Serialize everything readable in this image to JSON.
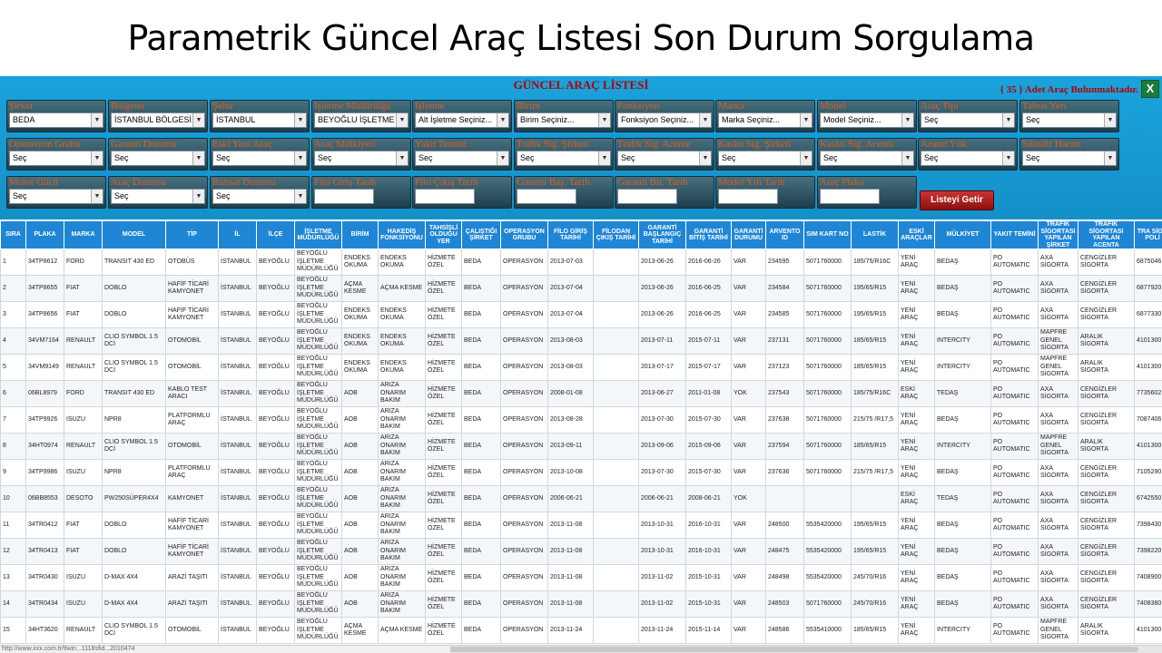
{
  "slide_title": "Parametrik Güncel Araç Listesi Son Durum Sorgulama",
  "panel": {
    "title": "GÜNCEL ARAÇ LİSTESİ",
    "count_text": "{ 35 } Adet Araç Bulunmaktadır.",
    "excel_icon": "excel-export-icon",
    "get_button": "Listeyi Getir"
  },
  "filters_row1": [
    {
      "label": "Şirket",
      "value": "BEDA"
    },
    {
      "label": "Bölgeler",
      "value": "İSTANBUL BÖLGESİ"
    },
    {
      "label": "Şehir",
      "value": "İSTANBUL"
    },
    {
      "label": "İşletme Müdürlüğü",
      "value": "BEYOĞLU İŞLETME"
    },
    {
      "label": "İşletme",
      "value": "Alt İşletme Seçiniz..."
    },
    {
      "label": "Birim",
      "value": "Birim Seçiniz..."
    },
    {
      "label": "Fonksiyon",
      "value": "Fonksiyon Seçiniz..."
    },
    {
      "label": "Marka",
      "value": "Marka Seçiniz..."
    },
    {
      "label": "Model",
      "value": "Model Seçiniz..."
    },
    {
      "label": "Araç Tipi",
      "value": "Seç"
    },
    {
      "label": "Tahsis Yeri",
      "value": "Seç"
    }
  ],
  "filters_row2": [
    {
      "label": "Operasyon Grubu",
      "value": "Seç"
    },
    {
      "label": "Garanti Durumu",
      "value": "Seç"
    },
    {
      "label": "Eski Yeni Araç",
      "value": "Seç"
    },
    {
      "label": "Araç Mülkiyeti",
      "value": "Seç"
    },
    {
      "label": "Yakıt Temini",
      "value": "Seç"
    },
    {
      "label": "Trafik Sig. Şirketi",
      "value": "Seç"
    },
    {
      "label": "Trafik Sig. Acente",
      "value": "Seç"
    },
    {
      "label": "Kasko Sig. Şirketi",
      "value": "Seç"
    },
    {
      "label": "Kasko Sig. Acente",
      "value": "Seç"
    },
    {
      "label": "Azami Yük",
      "value": "Seç"
    },
    {
      "label": "Silindir Hacmi",
      "value": "Seç"
    }
  ],
  "filters_row3_selects": [
    {
      "label": "Motor Gücü",
      "value": "Seç"
    },
    {
      "label": "Araç Durumu",
      "value": "Seç"
    },
    {
      "label": "Ruhsat Durumu",
      "value": "Seç"
    }
  ],
  "filters_row3_inputs": [
    {
      "label": "Filo Giriş Tarih",
      "value": ""
    },
    {
      "label": "Filo Çıkış Tarih",
      "value": ""
    },
    {
      "label": "Garanti Baş. Tarih",
      "value": ""
    },
    {
      "label": "Garanti Bit. Tarih",
      "value": ""
    },
    {
      "label": "Model Yılı Tarih",
      "value": ""
    },
    {
      "label": "Araç Plaka",
      "value": ""
    }
  ],
  "columns": [
    "SIRA",
    "PLAKA",
    "MARKA",
    "MODEL",
    "TİP",
    "İL",
    "İLÇE",
    "İŞLETME MÜDÜRLÜĞÜ",
    "BİRİM",
    "HAKEDİŞ FONKSİYONU",
    "TAHSİSLİ OLDUĞU YER",
    "ÇALIŞTIĞI ŞİRKET",
    "OPERASYON GRUBU",
    "FİLO GİRİŞ TARİHİ",
    "FİLODAN ÇIKIŞ TARİHİ",
    "GARANTİ BAŞLANGIÇ TARİHİ",
    "GARANTİ BİTİŞ TARİHİ",
    "GARANTİ DURUMU",
    "ARVENTO ID",
    "SIM KART NO",
    "LASTİK",
    "ESKİ ARAÇLAR",
    "MÜLKİYET",
    "YAKIT TEMİNİ",
    "TRAFİK SİGORTASI YAPILAN ŞİRKET",
    "TRAFİK SİGORTASI YAPILAN ACENTA",
    "TRA SİGO POLİ"
  ],
  "rows": [
    [
      "1",
      "34TP8612",
      "FORD",
      "TRANSIT 430 ED",
      "OTOBÜS",
      "İSTANBUL",
      "BEYOĞLU",
      "BEYOĞLU İŞLETME MÜDÜRLÜĞÜ",
      "ENDEKS OKUMA",
      "ENDEKS OKUMA",
      "HİZMETE ÖZEL",
      "BEDA",
      "OPERASYON",
      "2013-07-03",
      "",
      "2013-06-26",
      "2016-06-26",
      "VAR",
      "234595",
      "5071760000",
      "185/75/R16C",
      "YENİ ARAÇ",
      "BEDAŞ",
      "PO AUTOMATIC",
      "AXA SİGORTA",
      "CENGİZLER SİGORTA",
      "6875046"
    ],
    [
      "2",
      "34TP8655",
      "FIAT",
      "DOBLO",
      "HAFİF TİCARİ KAMYONET",
      "İSTANBUL",
      "BEYOĞLU",
      "BEYOĞLU İŞLETME MÜDÜRLÜĞÜ",
      "AÇMA KESME",
      "AÇMA KESME",
      "HİZMETE ÖZEL",
      "BEDA",
      "OPERASYON",
      "2013-07-04",
      "",
      "2013-06-26",
      "2016-06-25",
      "VAR",
      "234584",
      "5071760000",
      "195/65/R15",
      "YENİ ARAÇ",
      "BEDAŞ",
      "PO AUTOMATIC",
      "AXA SİGORTA",
      "CENGİZLER SİGORTA",
      "6877920"
    ],
    [
      "3",
      "34TP8656",
      "FIAT",
      "DOBLO",
      "HAFİF TİCARİ KAMYONET",
      "İSTANBUL",
      "BEYOĞLU",
      "BEYOĞLU İŞLETME MÜDÜRLÜĞÜ",
      "ENDEKS OKUMA",
      "ENDEKS OKUMA",
      "HİZMETE ÖZEL",
      "BEDA",
      "OPERASYON",
      "2013-07-04",
      "",
      "2013-06-26",
      "2016-06-25",
      "VAR",
      "234585",
      "5071760000",
      "195/65/R15",
      "YENİ ARAÇ",
      "BEDAŞ",
      "PO AUTOMATIC",
      "AXA SİGORTA",
      "CENGİZLER SİGORTA",
      "6877330"
    ],
    [
      "4",
      "34VM7164",
      "RENAULT",
      "CLIO SYMBOL 1.5 DCİ",
      "OTOMOBİL",
      "İSTANBUL",
      "BEYOĞLU",
      "BEYOĞLU İŞLETME MÜDÜRLÜĞÜ",
      "ENDEKS OKUMA",
      "ENDEKS OKUMA",
      "HİZMETE ÖZEL",
      "BEDA",
      "OPERASYON",
      "2013-08-03",
      "",
      "2013-07-11",
      "2015-07-11",
      "VAR",
      "237131",
      "5071760000",
      "185/65/R15",
      "YENİ ARAÇ",
      "INTERCITY",
      "PO AUTOMATIC",
      "MAPFRE GENEL SİGORTA",
      "ARALIK SİGORTA",
      "4101300"
    ],
    [
      "5",
      "34VM9149",
      "RENAULT",
      "CLIO SYMBOL 1.5 DCİ",
      "OTOMOBİL",
      "İSTANBUL",
      "BEYOĞLU",
      "BEYOĞLU İŞLETME MÜDÜRLÜĞÜ",
      "ENDEKS OKUMA",
      "ENDEKS OKUMA",
      "HİZMETE ÖZEL",
      "BEDA",
      "OPERASYON",
      "2013-08-03",
      "",
      "2013-07-17",
      "2015-07-17",
      "VAR",
      "237123",
      "5071760000",
      "185/65/R15",
      "YENİ ARAÇ",
      "INTERCITY",
      "PO AUTOMATIC",
      "MAPFRE GENEL SİGORTA",
      "ARALIK SİGORTA",
      "4101300"
    ],
    [
      "6",
      "06BL8979",
      "FORD",
      "TRANSIT 430 ED",
      "KABLO TEST ARACI",
      "İSTANBUL",
      "BEYOĞLU",
      "BEYOĞLU İŞLETME MÜDÜRLÜĞÜ",
      "AOB",
      "ARIZA ONARIM BAKIM",
      "HİZMETE ÖZEL",
      "BEDA",
      "OPERASYON",
      "2008-01-08",
      "",
      "2013-06-27",
      "2011-01-08",
      "YOK",
      "237543",
      "5071760000",
      "185/75/R16C",
      "ESKİ ARAÇ",
      "TEDAŞ",
      "PO AUTOMATIC",
      "AXA SİGORTA",
      "CENGİZLER SİGORTA",
      "7735602"
    ],
    [
      "7",
      "34TP9926",
      "ISUZU",
      "NPR8",
      "PLATFORMLU ARAÇ",
      "İSTANBUL",
      "BEYOĞLU",
      "BEYOĞLU İŞLETME MÜDÜRLÜĞÜ",
      "AOB",
      "ARIZA ONARIM BAKIM",
      "HİZMETE ÖZEL",
      "BEDA",
      "OPERASYON",
      "2013-08-28",
      "",
      "2013-07-30",
      "2015-07-30",
      "VAR",
      "237638",
      "5071760000",
      "215/75 /R17,5",
      "YENİ ARAÇ",
      "BEDAŞ",
      "PO AUTOMATIC",
      "AXA SİGORTA",
      "CENGİZLER SİGORTA",
      "7087406"
    ],
    [
      "8",
      "34HT0974",
      "RENAULT",
      "CLIO SYMBOL 1.5 DCİ",
      "OTOMOBİL",
      "İSTANBUL",
      "BEYOĞLU",
      "BEYOĞLU İŞLETME MÜDÜRLÜĞÜ",
      "AOB",
      "ARIZA ONARIM BAKIM",
      "HİZMETE ÖZEL",
      "BEDA",
      "OPERASYON",
      "2013-09-11",
      "",
      "2013-09-06",
      "2015-09-06",
      "VAR",
      "237594",
      "5071760000",
      "185/65/R15",
      "YENİ ARAÇ",
      "INTERCITY",
      "PO AUTOMATIC",
      "MAPFRE GENEL SİGORTA",
      "ARALIK SİGORTA",
      "4101300"
    ],
    [
      "9",
      "34TP9986",
      "ISUZU",
      "NPR8",
      "PLATFORMLU ARAÇ",
      "İSTANBUL",
      "BEYOĞLU",
      "BEYOĞLU İŞLETME MÜDÜRLÜĞÜ",
      "AOB",
      "ARIZA ONARIM BAKIM",
      "HİZMETE ÖZEL",
      "BEDA",
      "OPERASYON",
      "2013-10-08",
      "",
      "2013-07-30",
      "2015-07-30",
      "VAR",
      "237636",
      "5071760000",
      "215/75 /R17,5",
      "YENİ ARAÇ",
      "BEDAŞ",
      "PO AUTOMATIC",
      "AXA SİGORTA",
      "CENGİZLER SİGORTA",
      "7105290"
    ],
    [
      "10",
      "06BB8553",
      "DESOTO",
      "PW250SÜPER4X4",
      "KAMYONET",
      "İSTANBUL",
      "BEYOĞLU",
      "BEYOĞLU İŞLETME MÜDÜRLÜĞÜ",
      "AOB",
      "ARIZA ONARIM BAKIM",
      "HİZMETE ÖZEL",
      "BEDA",
      "OPERASYON",
      "2006-06-21",
      "",
      "2006-06-21",
      "2008-06-21",
      "YOK",
      "",
      "",
      "",
      "ESKİ ARAÇ",
      "TEDAŞ",
      "PO AUTOMATIC",
      "AXA SİGORTA",
      "CENGİZLER SİGORTA",
      "6742550"
    ],
    [
      "11",
      "34TR0412",
      "FIAT",
      "DOBLO",
      "HAFİF TİCARİ KAMYONET",
      "İSTANBUL",
      "BEYOĞLU",
      "BEYOĞLU İŞLETME MÜDÜRLÜĞÜ",
      "AOB",
      "ARIZA ONARIM BAKIM",
      "HİZMETE ÖZEL",
      "BEDA",
      "OPERASYON",
      "2013-11-08",
      "",
      "2013-10-31",
      "2016-10-31",
      "VAR",
      "248500",
      "5535420000",
      "195/65/R15",
      "YENİ ARAÇ",
      "BEDAŞ",
      "PO AUTOMATIC",
      "AXA SİGORTA",
      "CENGİZLER SİGORTA",
      "7398430"
    ],
    [
      "12",
      "34TR0413",
      "FIAT",
      "DOBLO",
      "HAFİF TİCARİ KAMYONET",
      "İSTANBUL",
      "BEYOĞLU",
      "BEYOĞLU İŞLETME MÜDÜRLÜĞÜ",
      "AOB",
      "ARIZA ONARIM BAKIM",
      "HİZMETE ÖZEL",
      "BEDA",
      "OPERASYON",
      "2013-11-08",
      "",
      "2013-10-31",
      "2016-10-31",
      "VAR",
      "248475",
      "5535420000",
      "195/65/R15",
      "YENİ ARAÇ",
      "BEDAŞ",
      "PO AUTOMATIC",
      "AXA SİGORTA",
      "CENGİZLER SİGORTA",
      "7398220"
    ],
    [
      "13",
      "34TR0430",
      "ISUZU",
      "D-MAX 4X4",
      "ARAZİ TAŞITI",
      "İSTANBUL",
      "BEYOĞLU",
      "BEYOĞLU İŞLETME MÜDÜRLÜĞÜ",
      "AOB",
      "ARIZA ONARIM BAKIM",
      "HİZMETE ÖZEL",
      "BEDA",
      "OPERASYON",
      "2013-11-08",
      "",
      "2013-11-02",
      "2015-10-31",
      "VAR",
      "248498",
      "5535420000",
      "245/70/R16",
      "YENİ ARAÇ",
      "BEDAŞ",
      "PO AUTOMATIC",
      "AXA SİGORTA",
      "CENGİZLER SİGORTA",
      "7408900"
    ],
    [
      "14",
      "34TR0434",
      "ISUZU",
      "D-MAX 4X4",
      "ARAZİ TAŞITI",
      "İSTANBUL",
      "BEYOĞLU",
      "BEYOĞLU İŞLETME MÜDÜRLÜĞÜ",
      "AOB",
      "ARIZA ONARIM BAKIM",
      "HİZMETE ÖZEL",
      "BEDA",
      "OPERASYON",
      "2013-11-08",
      "",
      "2013-11-02",
      "2015-10-31",
      "VAR",
      "248503",
      "5071760000",
      "245/70/R16",
      "YENİ ARAÇ",
      "BEDAŞ",
      "PO AUTOMATIC",
      "AXA SİGORTA",
      "CENGİZLER SİGORTA",
      "7408380"
    ],
    [
      "15",
      "34HT3620",
      "RENAULT",
      "CLIO SYMBOL 1.5 DCİ",
      "OTOMOBİL",
      "İSTANBUL",
      "BEYOĞLU",
      "BEYOĞLU İŞLETME MÜDÜRLÜĞÜ",
      "AÇMA KESME",
      "AÇMA KESME",
      "HİZMETE ÖZEL",
      "BEDA",
      "OPERASYON",
      "2013-11-24",
      "",
      "2013-11-24",
      "2015-11-14",
      "VAR",
      "248586",
      "5535410000",
      "185/65/R15",
      "YENİ ARAÇ",
      "INTERCITY",
      "PO AUTOMATIC",
      "MAPFRE GENEL SİGORTA",
      "ARALIK SİGORTA",
      "4101300"
    ]
  ],
  "status_url": "http://www.xxx.com.tr/tlwin...1118sfid...2010474"
}
